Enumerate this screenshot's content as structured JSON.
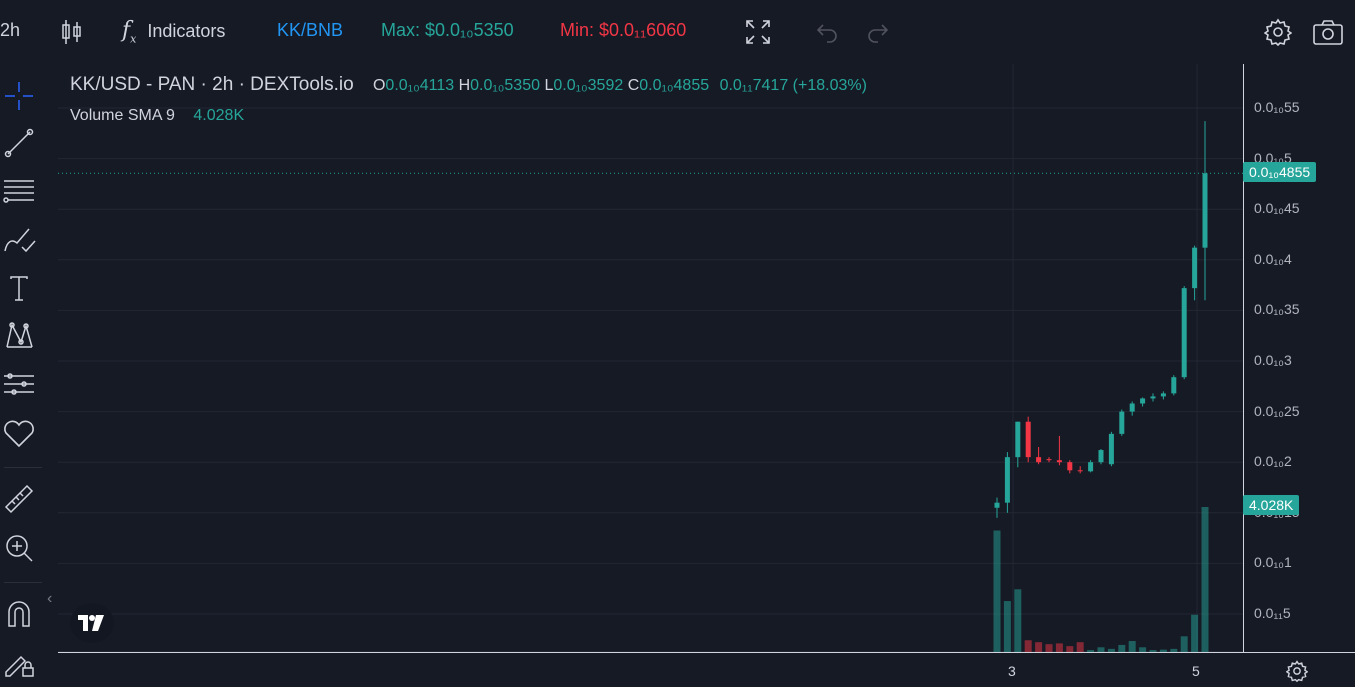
{
  "toolbar": {
    "interval": "2h",
    "indicators_label": "Indicators",
    "pair": "KK/BNB",
    "max_label": "Max: $0.0₁₀5350",
    "min_label": "Min: $0.0₁₁6060",
    "colors": {
      "pair": "#2196f3",
      "max": "#26a69a",
      "min": "#f23645"
    }
  },
  "sidebar": {
    "icons": [
      "crosshair-icon",
      "trendline-icon",
      "fib-icon",
      "brush-icon",
      "text-icon",
      "pattern-icon",
      "forecast-icon",
      "heart-icon",
      "ruler-icon",
      "zoom-icon",
      "magnet-icon",
      "lock-pencil-icon"
    ],
    "collapse_glyph": "‹"
  },
  "legend": {
    "title": "KK/USD - PAN · 2h · DEXTools.io",
    "o_key": "O",
    "o_val": "0.0₁₀4113",
    "h_key": "H",
    "h_val": "0.0₁₀5350",
    "l_key": "L",
    "l_val": "0.0₁₀3592",
    "c_key": "C",
    "c_val": "0.0₁₀4855",
    "change": "0.0₁₁7417 (+18.03%)",
    "volume_label": "Volume SMA 9",
    "volume_value": "4.028K"
  },
  "chart_data": {
    "type": "candlestick",
    "title": "KK/USD - PAN · 2h · DEXTools.io",
    "price_unit_note": "prices in units of 1e-11 USD (0.0₁₀X)",
    "y_ticks": [
      "0.0₁₀55",
      "0.0₁₀5",
      "0.0₁₀45",
      "0.0₁₀4",
      "0.0₁₀35",
      "0.0₁₀3",
      "0.0₁₀25",
      "0.0₁₀2",
      "0.0₁₀15",
      "0.0₁₀1",
      "0.0₁₁5"
    ],
    "y_tick_values": [
      5.5,
      5.0,
      4.5,
      4.0,
      3.5,
      3.0,
      2.5,
      2.0,
      1.5,
      1.0,
      0.5
    ],
    "ylim": [
      0.0,
      5.9
    ],
    "x_ticks": [
      "3",
      "5"
    ],
    "last_price_label": "0.0₁₀4855",
    "last_price": 4.855,
    "volume_label": "4.028K",
    "candles": [
      {
        "o": 1.55,
        "h": 1.65,
        "l": 1.45,
        "c": 1.6
      },
      {
        "o": 1.6,
        "h": 2.1,
        "l": 1.5,
        "c": 2.05
      },
      {
        "o": 2.05,
        "h": 2.4,
        "l": 1.95,
        "c": 2.4
      },
      {
        "o": 2.4,
        "h": 2.45,
        "l": 2.0,
        "c": 2.05
      },
      {
        "o": 2.05,
        "h": 2.15,
        "l": 1.98,
        "c": 2.0
      },
      {
        "o": 2.03,
        "h": 2.05,
        "l": 2.0,
        "c": 2.02
      },
      {
        "o": 2.02,
        "h": 2.26,
        "l": 1.97,
        "c": 2.0
      },
      {
        "o": 2.0,
        "h": 2.02,
        "l": 1.89,
        "c": 1.92
      },
      {
        "o": 1.92,
        "h": 1.96,
        "l": 1.89,
        "c": 1.91
      },
      {
        "o": 1.91,
        "h": 2.02,
        "l": 1.9,
        "c": 2.0
      },
      {
        "o": 2.0,
        "h": 2.13,
        "l": 1.98,
        "c": 2.12
      },
      {
        "o": 1.98,
        "h": 2.3,
        "l": 1.96,
        "c": 2.28
      },
      {
        "o": 2.28,
        "h": 2.52,
        "l": 2.26,
        "c": 2.5
      },
      {
        "o": 2.5,
        "h": 2.6,
        "l": 2.46,
        "c": 2.58
      },
      {
        "o": 2.58,
        "h": 2.64,
        "l": 2.55,
        "c": 2.63
      },
      {
        "o": 2.63,
        "h": 2.68,
        "l": 2.6,
        "c": 2.65
      },
      {
        "o": 2.65,
        "h": 2.7,
        "l": 2.62,
        "c": 2.68
      },
      {
        "o": 2.68,
        "h": 2.86,
        "l": 2.66,
        "c": 2.84
      },
      {
        "o": 2.84,
        "h": 3.74,
        "l": 2.82,
        "c": 3.72
      },
      {
        "o": 3.72,
        "h": 4.14,
        "l": 3.6,
        "c": 4.12
      },
      {
        "o": 4.12,
        "h": 5.37,
        "l": 3.6,
        "c": 4.855
      }
    ],
    "volumes": [
      3.1,
      1.3,
      1.6,
      0.3,
      0.25,
      0.2,
      0.22,
      0.15,
      0.25,
      0.05,
      0.12,
      0.08,
      0.18,
      0.28,
      0.12,
      0.05,
      0.06,
      0.08,
      0.4,
      0.95,
      3.7
    ]
  }
}
